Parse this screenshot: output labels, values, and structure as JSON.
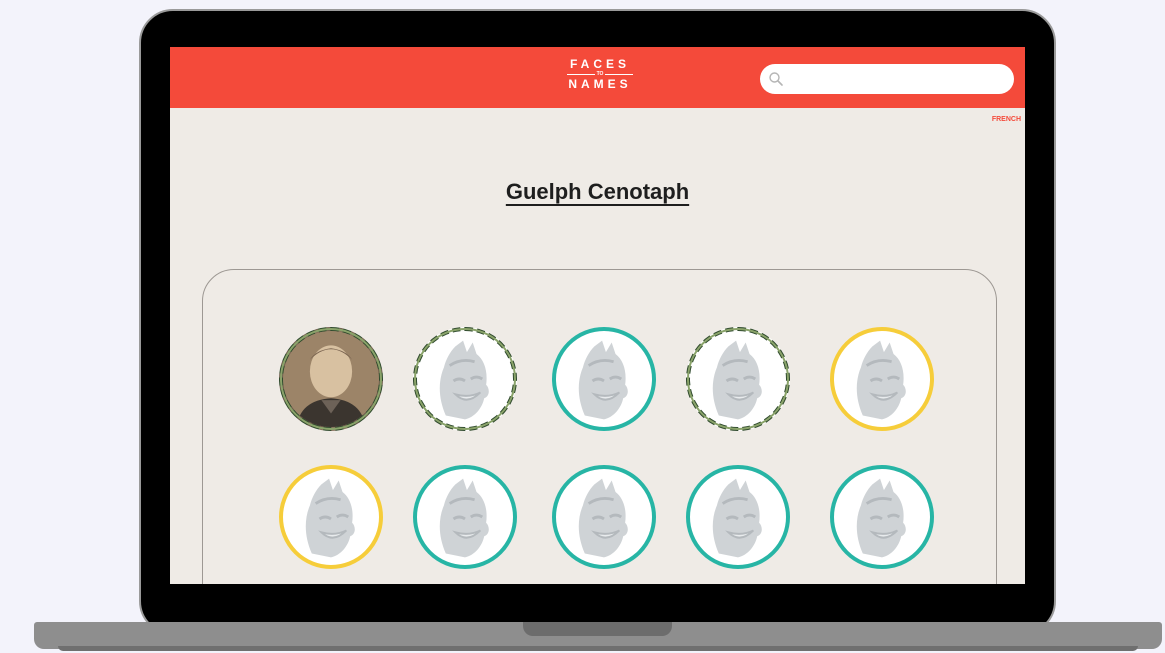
{
  "header": {
    "logo_line1": "FACES",
    "logo_to": "TO",
    "logo_line2": "NAMES",
    "search_placeholder": "",
    "language_link": "FRENCH"
  },
  "page": {
    "title": "Guelph Cenotaph"
  },
  "colors": {
    "header_red": "#f44a3a",
    "page_bg": "#efebe6",
    "teal_ring": "#27b5a5",
    "yellow_ring": "#f6cd3a",
    "camo_ring": "#2f4a2d"
  },
  "profiles": [
    {
      "ring": "camo",
      "image": "photo"
    },
    {
      "ring": "camo",
      "image": "placeholder-face"
    },
    {
      "ring": "teal",
      "image": "placeholder-face"
    },
    {
      "ring": "camo",
      "image": "placeholder-face"
    },
    {
      "ring": "yellow",
      "image": "placeholder-face"
    },
    {
      "ring": "yellow",
      "image": "placeholder-face"
    },
    {
      "ring": "teal",
      "image": "placeholder-face"
    },
    {
      "ring": "teal",
      "image": "placeholder-face"
    },
    {
      "ring": "teal",
      "image": "placeholder-face"
    },
    {
      "ring": "teal",
      "image": "placeholder-face"
    }
  ]
}
